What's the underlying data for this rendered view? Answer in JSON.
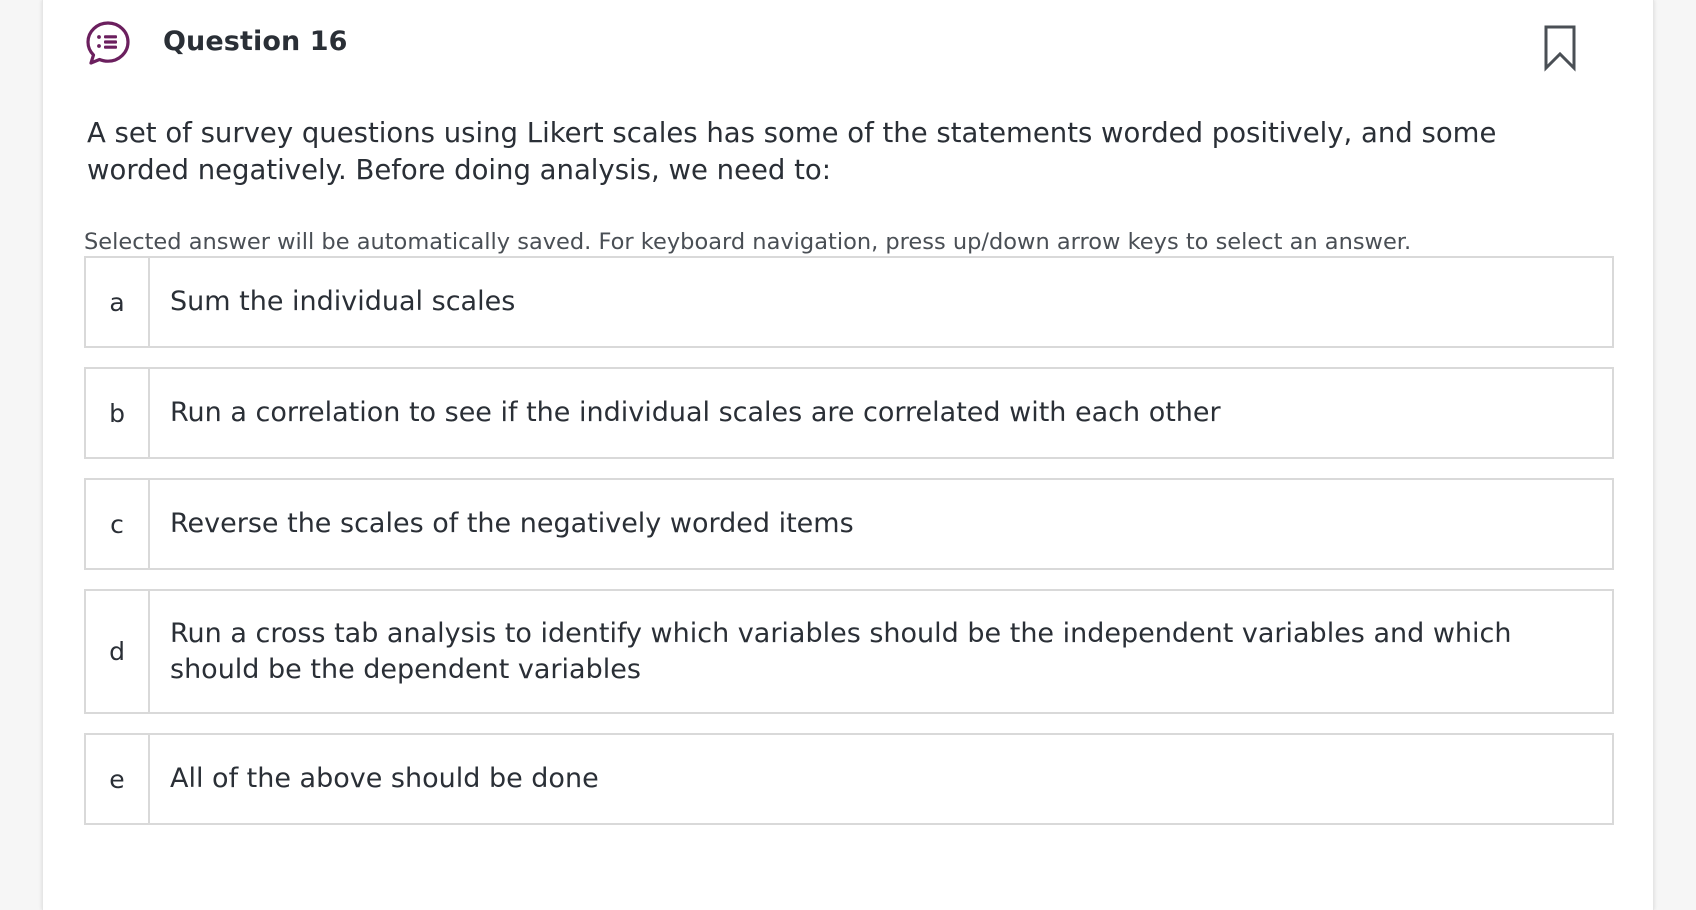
{
  "question": {
    "title": "Question 16",
    "icon": "speech-bubble-list-icon",
    "bookmark_icon": "bookmark-icon",
    "prompt": "A set of survey questions using Likert scales has some of the statements worded positively, and some worded negatively. Before doing analysis, we need to:",
    "instructions": "Selected answer will be automatically saved. For keyboard navigation, press up/down arrow keys to select an answer."
  },
  "options": [
    {
      "letter": "a",
      "text": "Sum the individual scales"
    },
    {
      "letter": "b",
      "text": "Run a correlation to see if the individual scales are correlated with each other"
    },
    {
      "letter": "c",
      "text": "Reverse the scales of the negatively worded items"
    },
    {
      "letter": "d",
      "text": "Run a cross tab analysis to identify which variables should be the independent variables and which should be the dependent variables"
    },
    {
      "letter": "e",
      "text": "All of the above should be done"
    }
  ],
  "colors": {
    "icon_accent": "#6b1f5e",
    "border": "#d9d9d9",
    "text": "#2a2f36"
  }
}
